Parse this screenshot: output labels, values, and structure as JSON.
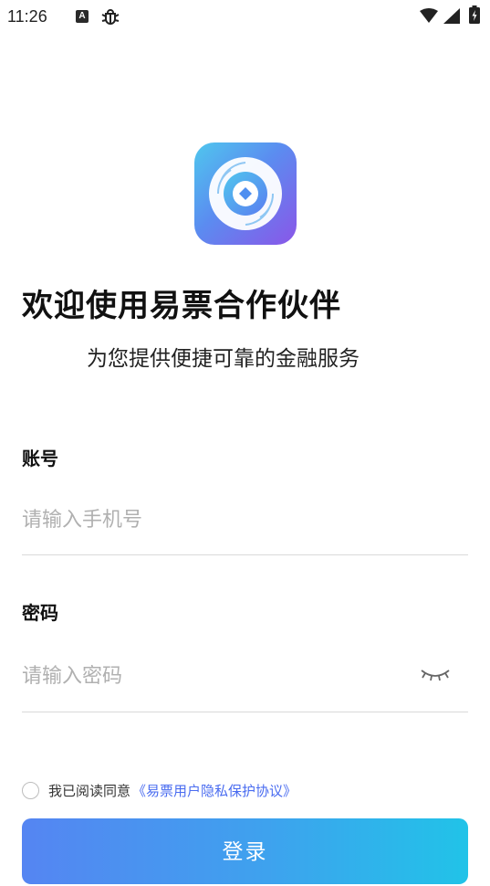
{
  "status_bar": {
    "time": "11:26",
    "a_badge": "A"
  },
  "welcome": {
    "title": "欢迎使用易票合作伙伴",
    "subtitle": "为您提供便捷可靠的金融服务"
  },
  "form": {
    "account": {
      "label": "账号",
      "placeholder": "请输入手机号"
    },
    "password": {
      "label": "密码",
      "placeholder": "请输入密码"
    }
  },
  "agreement": {
    "prefix": "我已阅读同意",
    "link": "《易票用户隐私保护协议》",
    "checked": false
  },
  "login_button": {
    "label": "登录"
  },
  "colors": {
    "accent": "#4a6cf0",
    "button_gradient_start": "#5585f2",
    "button_gradient_end": "#21c3e8"
  }
}
